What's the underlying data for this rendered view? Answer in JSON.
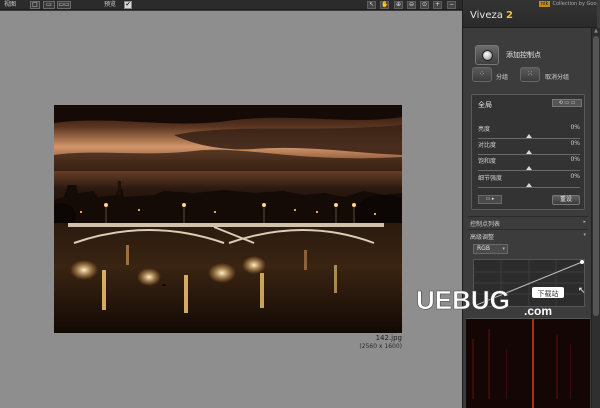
{
  "toolbar": {
    "view_label": "视图",
    "mode_icons": [
      "□",
      "▭",
      "▭▭"
    ],
    "preview_label": "预览",
    "preview_checked": "✔",
    "tool_icons": [
      "pointer-icon",
      "hand-icon",
      "zoom-in-icon",
      "zoom-out-icon",
      "zoom-fit-icon",
      "plus-icon",
      "minus-icon"
    ],
    "tool_glyphs": [
      "↖",
      "✋",
      "⊕",
      "⊖",
      "⊙",
      "+",
      "−"
    ]
  },
  "image": {
    "file_name": "142.jpg",
    "dimensions": "(2560 x 1600)"
  },
  "panel": {
    "brand": "Viveza",
    "brand_version": "2",
    "collection_tag": "nik",
    "collection_text": "Collection by Goo",
    "add_control_point": "添加控制点",
    "group": "分组",
    "ungroup": "取消分组",
    "global": {
      "title": "全局",
      "control_label": "⟲ ▭ ▭",
      "sliders": [
        {
          "label": "亮度",
          "value": "0%",
          "position": 0.5
        },
        {
          "label": "对比度",
          "value": "0%",
          "position": 0.5
        },
        {
          "label": "饱和度",
          "value": "0%",
          "position": 0.5
        },
        {
          "label": "细节强度",
          "value": "0%",
          "position": 0.5
        }
      ],
      "small_button": "▭ ▸",
      "reset": "重设"
    },
    "sections": [
      {
        "label": "控制点列表",
        "arrow": "▸"
      },
      {
        "label": "高级调整",
        "arrow": "▾"
      }
    ],
    "channel_select": "RGB",
    "watermark": {
      "logo": "UEBUG",
      "domain": ".com",
      "badge": "下载站"
    }
  },
  "colors": {
    "canvas_bg": "#8e8e8e",
    "panel_bg": "#3c3c3c",
    "accent": "#f0c040"
  }
}
